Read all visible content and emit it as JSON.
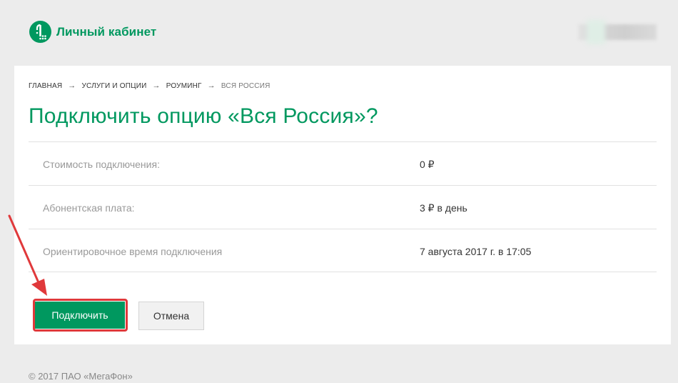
{
  "header": {
    "logo_text": "Личный кабинет",
    "brand_color": "#00985f"
  },
  "breadcrumb": [
    {
      "label": "Главная"
    },
    {
      "label": "Услуги и опции"
    },
    {
      "label": "Роуминг"
    },
    {
      "label": "Вся Россия"
    }
  ],
  "breadcrumb_separator": "→",
  "page_title": "Подключить опцию «Вся Россия»?",
  "details": [
    {
      "label": "Стоимость подключения:",
      "value": "0 ₽"
    },
    {
      "label": "Абонентская плата:",
      "value": "3 ₽ в день"
    },
    {
      "label": "Ориентировочное время подключения",
      "value": "7 августа 2017 г. в 17:05"
    }
  ],
  "actions": {
    "connect_label": "Подключить",
    "cancel_label": "Отмена"
  },
  "footer": {
    "copyright": "© 2017 ПАО «МегаФон»"
  },
  "annotation": {
    "highlight_color": "#e0393b"
  }
}
